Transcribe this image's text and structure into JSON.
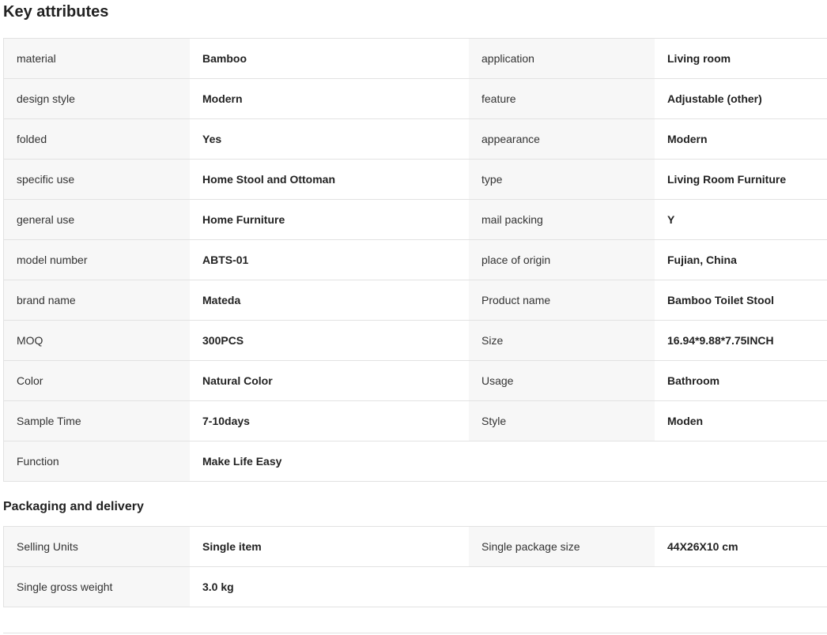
{
  "key_attributes": {
    "title": "Key attributes",
    "rows": [
      {
        "l1": "material",
        "v1": "Bamboo",
        "l2": "application",
        "v2": "Living room"
      },
      {
        "l1": "design style",
        "v1": "Modern",
        "l2": "feature",
        "v2": "Adjustable (other)"
      },
      {
        "l1": "folded",
        "v1": "Yes",
        "l2": "appearance",
        "v2": "Modern"
      },
      {
        "l1": "specific use",
        "v1": "Home Stool and Ottoman",
        "l2": "type",
        "v2": "Living Room Furniture"
      },
      {
        "l1": "general use",
        "v1": "Home Furniture",
        "l2": "mail packing",
        "v2": "Y"
      },
      {
        "l1": "model number",
        "v1": "ABTS-01",
        "l2": "place of origin",
        "v2": "Fujian, China"
      },
      {
        "l1": "brand name",
        "v1": "Mateda",
        "l2": "Product name",
        "v2": "Bamboo Toilet Stool"
      },
      {
        "l1": "MOQ",
        "v1": "300PCS",
        "l2": "Size",
        "v2": "16.94*9.88*7.75INCH"
      },
      {
        "l1": "Color",
        "v1": "Natural Color",
        "l2": "Usage",
        "v2": "Bathroom"
      },
      {
        "l1": "Sample Time",
        "v1": "7-10days",
        "l2": "Style",
        "v2": "Moden"
      },
      {
        "l1": "Function",
        "v1": "Make Life Easy",
        "l2": "",
        "v2": ""
      }
    ]
  },
  "packaging": {
    "title": "Packaging and delivery",
    "rows": [
      {
        "l1": "Selling Units",
        "v1": "Single item",
        "l2": "Single package size",
        "v2": "44X26X10 cm"
      },
      {
        "l1": "Single gross weight",
        "v1": "3.0 kg",
        "l2": "",
        "v2": ""
      }
    ]
  }
}
